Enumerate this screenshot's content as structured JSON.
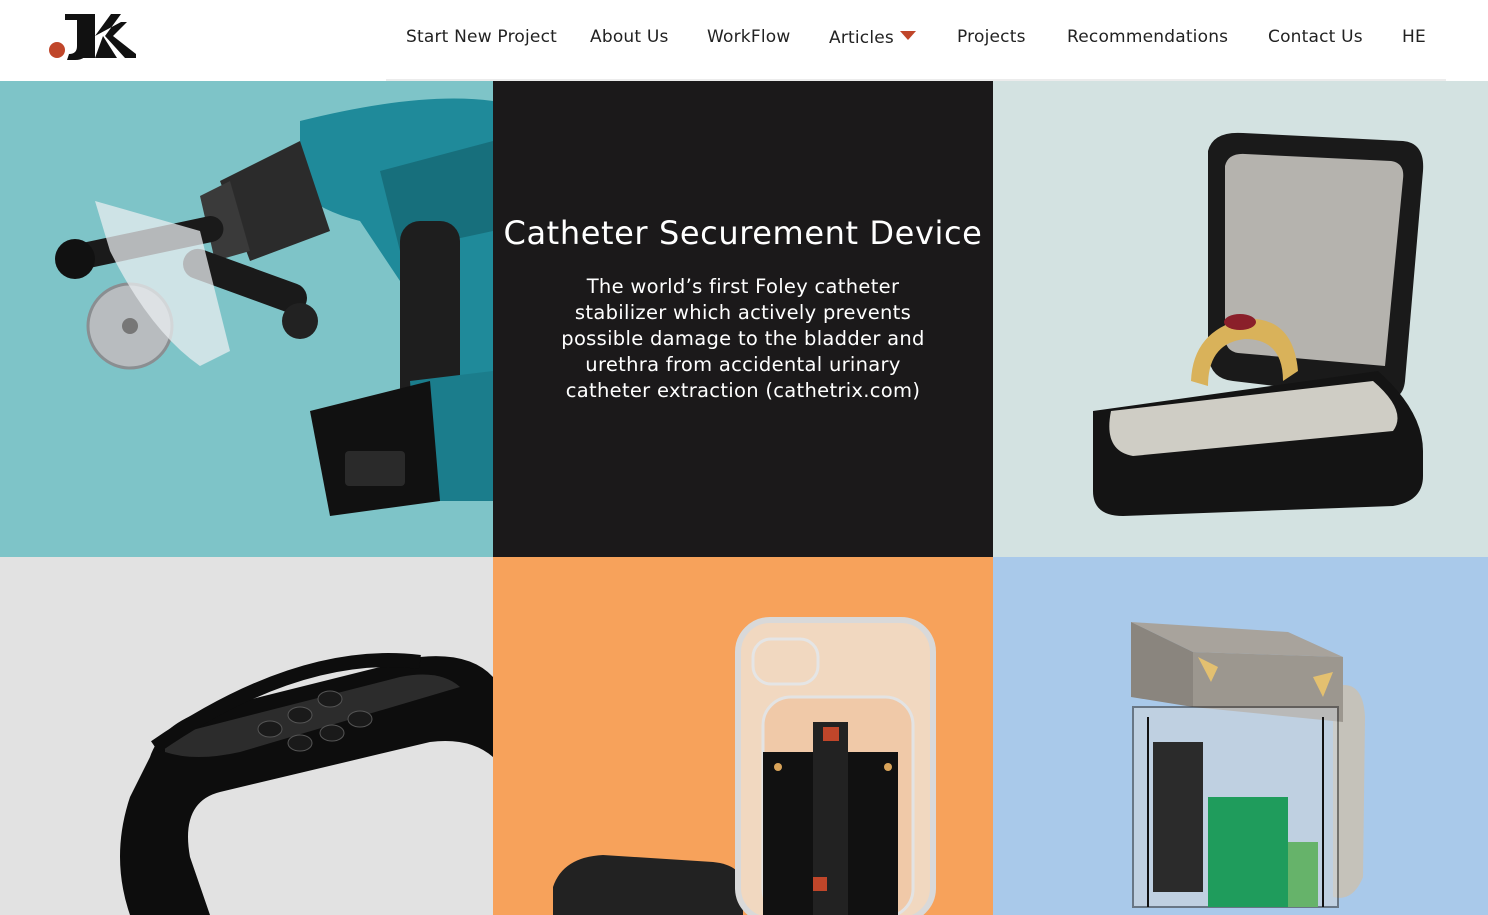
{
  "brand": {
    "logo_text": ".JK",
    "accent_color": "#c0462a"
  },
  "nav": {
    "items": [
      {
        "label": "Start New Project"
      },
      {
        "label": "About Us"
      },
      {
        "label": "WorkFlow"
      },
      {
        "label": "Articles",
        "has_dropdown": true
      },
      {
        "label": "Projects"
      },
      {
        "label": "Recommendations"
      },
      {
        "label": "Contact Us"
      },
      {
        "label": "HE"
      }
    ]
  },
  "feature": {
    "title": "Catheter Securement Device",
    "description": "The world’s first Foley catheter stabilizer which actively prevents possible damage to the bladder and urethra from accidental urinary catheter extraction (cathetrix.com)"
  },
  "tiles": [
    {
      "subject": "cordless drill with cutting disc attachment",
      "background": "#7ec4c8"
    },
    {
      "subject": "feature text panel",
      "background": "#1b191a"
    },
    {
      "subject": "gold ring in black ring box",
      "background": "#d3e2e1"
    },
    {
      "subject": "remote control holder grip",
      "background": "#e2e2e2"
    },
    {
      "subject": "transparent phone case with circuit board",
      "background": "#f7a25b"
    },
    {
      "subject": "electronic device enclosure",
      "background": "#a9c9ea"
    }
  ]
}
